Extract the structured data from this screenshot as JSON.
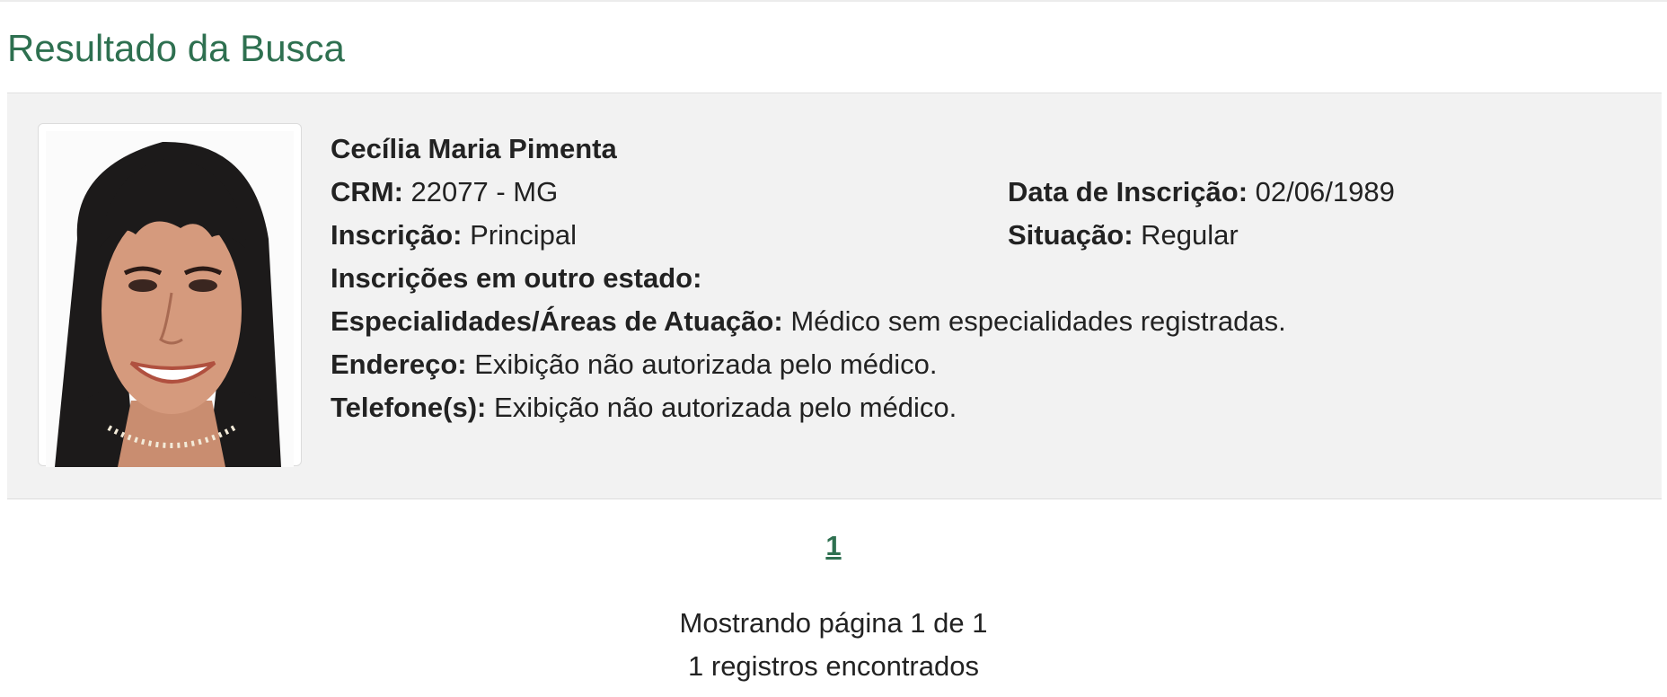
{
  "page": {
    "title": "Resultado da Busca"
  },
  "result": {
    "photo_alt": "doctor-photo",
    "name": "Cecília Maria Pimenta",
    "crm_label": "CRM:",
    "crm_value": "22077 - MG",
    "data_inscricao_label": "Data de Inscrição:",
    "data_inscricao_value": "02/06/1989",
    "inscricao_label": "Inscrição:",
    "inscricao_value": "Principal",
    "situacao_label": "Situação:",
    "situacao_value": "Regular",
    "outro_estado_label": "Inscrições em outro estado:",
    "outro_estado_value": "",
    "especialidades_label": "Especialidades/Áreas de Atuação:",
    "especialidades_value": "Médico sem especialidades registradas.",
    "endereco_label": "Endereço:",
    "endereco_value": "Exibição não autorizada pelo médico.",
    "telefone_label": "Telefone(s):",
    "telefone_value": "Exibição não autorizada pelo médico."
  },
  "pagination": {
    "current_page": "1",
    "status_line": "Mostrando página 1 de 1",
    "count_line": "1 registros encontrados"
  },
  "colors": {
    "accent": "#2e7050",
    "card_background": "#f2f2f2"
  }
}
